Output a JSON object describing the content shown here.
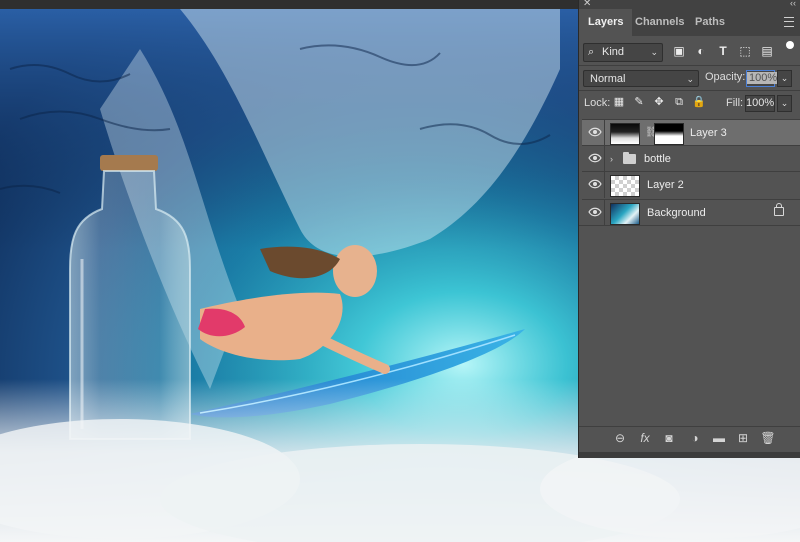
{
  "panel": {
    "close_glyph": "✕",
    "collapse_glyph": "‹‹",
    "tabs": [
      {
        "label": "Layers",
        "active": true
      },
      {
        "label": "Channels",
        "active": false
      },
      {
        "label": "Paths",
        "active": false
      }
    ],
    "filter": {
      "kind_label": "Kind",
      "icons": [
        "image-filter-icon",
        "adjustment-filter-icon",
        "type-filter-icon",
        "shape-filter-icon",
        "smart-object-filter-icon"
      ]
    },
    "blend_mode": "Normal",
    "opacity_label": "Opacity:",
    "opacity_value": "100%",
    "lock_label": "Lock:",
    "lock_icons": [
      "lock-transparent-pixels-icon",
      "lock-image-pixels-icon",
      "lock-position-icon",
      "lock-artboard-icon",
      "lock-all-icon"
    ],
    "fill_label": "Fill:",
    "fill_value": "100%",
    "layers": [
      {
        "name": "Layer 3",
        "selected": true,
        "visible": true,
        "has_mask": true
      },
      {
        "name": "bottle",
        "group": true,
        "visible": true
      },
      {
        "name": "Layer 2",
        "visible": true
      },
      {
        "name": "Background",
        "visible": true,
        "locked": true
      }
    ],
    "footer_icons": [
      "link-layers-icon",
      "fx-icon",
      "add-mask-icon",
      "adjustment-layer-icon",
      "new-group-icon",
      "new-layer-icon",
      "delete-layer-icon"
    ]
  },
  "colors": {
    "panel_bg": "#535353",
    "selected_layer": "#6e6e6e",
    "accent": "#4a7fd6"
  }
}
